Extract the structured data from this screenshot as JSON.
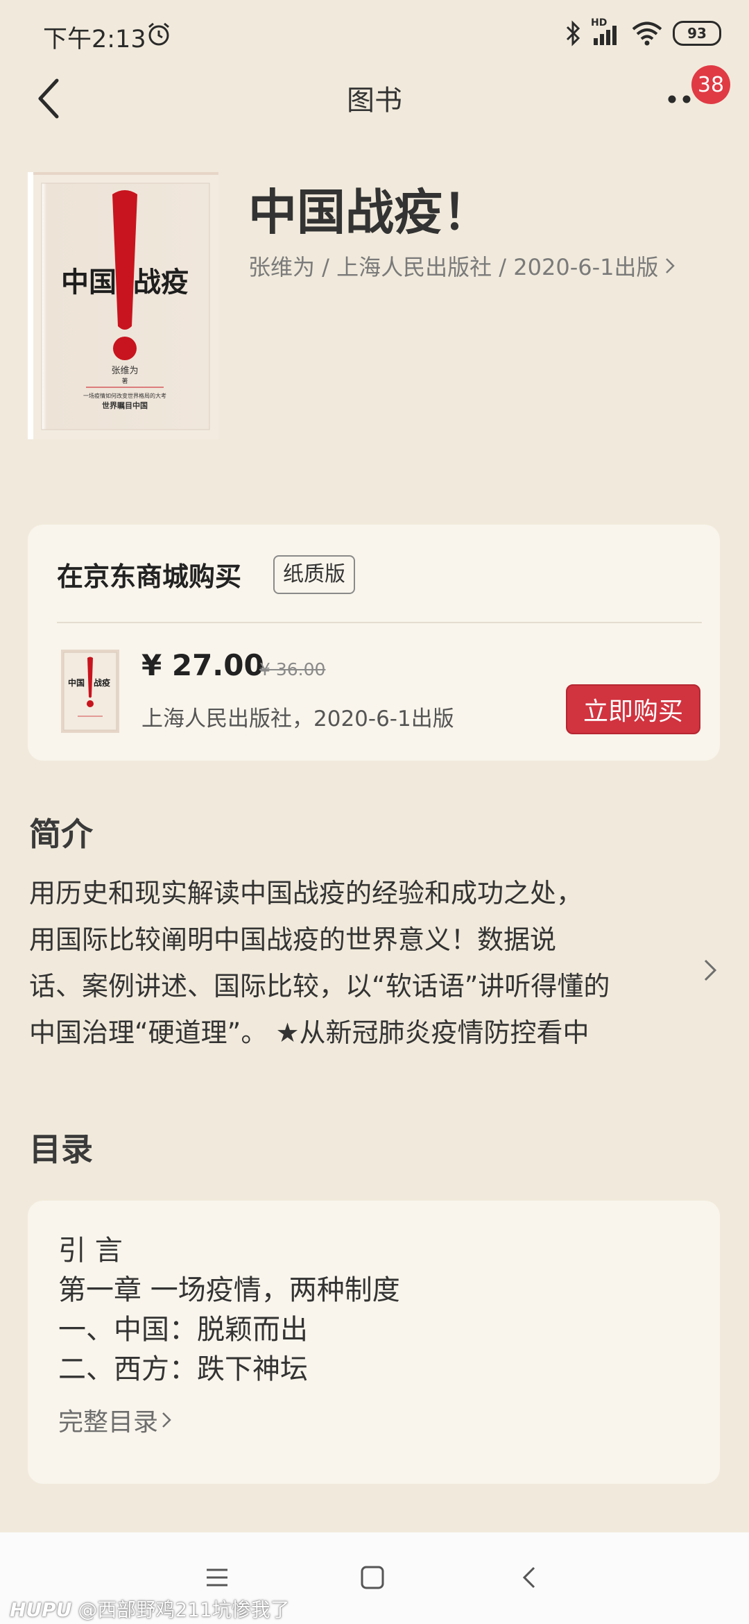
{
  "status_bar": {
    "time": "下午2:13",
    "signal_label": "HD",
    "battery": "93"
  },
  "header": {
    "title": "图书",
    "notification_count": "38"
  },
  "book": {
    "title": "中国战疫！",
    "meta": "张维为 / 上海人民出版社 / 2020-6-1出版",
    "cover_title_left": "中国",
    "cover_title_right": "战疫",
    "cover_author": "张维为",
    "cover_author_suffix": "著",
    "cover_tagline": "一场疫情如何改变世界格局的大考",
    "cover_subtitle": "世界瞩目中国"
  },
  "buy": {
    "title": "在京东商城购买",
    "edition_tag": "纸质版",
    "price": "¥ 27.00",
    "original_price": "¥ 36.00",
    "publisher_info": "上海人民出版社，2020-6-1出版",
    "button": "立即购买"
  },
  "intro": {
    "heading": "简介",
    "lines": [
      "用历史和现实解读中国战疫的经验和成功之处，",
      "用国际比较阐明中国战疫的世界意义！数据说",
      "话、案例讲述、国际比较，以“软话语”讲听得懂的",
      "中国治理“硬道理”。 ★从新冠肺炎疫情防控看中"
    ]
  },
  "toc": {
    "heading": "目录",
    "items": [
      "引 言",
      "第一章  一场疫情，两种制度",
      "一、中国：脱颖而出",
      "二、西方：跌下神坛"
    ],
    "full_link": "完整目录"
  },
  "watermark": {
    "brand": "HUPU",
    "text": "@西部野鸡211坑惨我了"
  },
  "colors": {
    "background": "#f1eadc",
    "card": "#f9f5ec",
    "accent_red": "#d1333f",
    "badge_red": "#e03a45"
  }
}
